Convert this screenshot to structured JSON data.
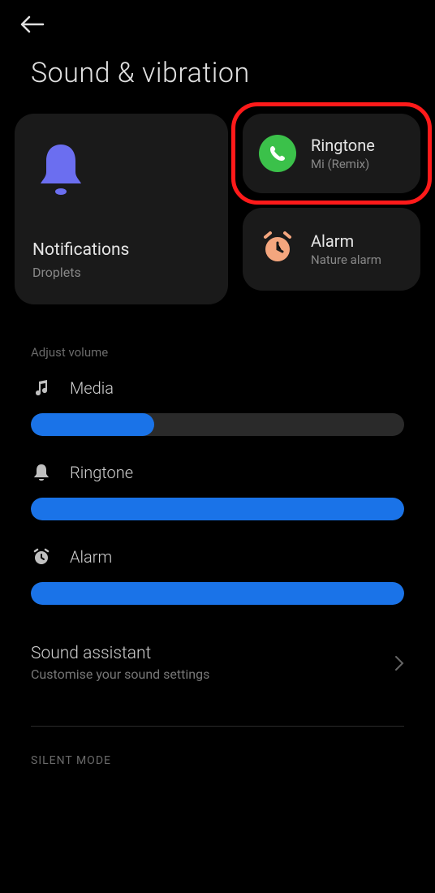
{
  "page": {
    "title": "Sound & vibration"
  },
  "cards": {
    "notifications": {
      "title": "Notifications",
      "sub": "Droplets"
    },
    "ringtone": {
      "title": "Ringtone",
      "sub": "Mi (Remix)"
    },
    "alarm": {
      "title": "Alarm",
      "sub": "Nature alarm"
    }
  },
  "volumes": {
    "section_label": "Adjust volume",
    "media": {
      "label": "Media",
      "percent": 33
    },
    "ringtone": {
      "label": "Ringtone",
      "percent": 100
    },
    "alarm": {
      "label": "Alarm",
      "percent": 100
    }
  },
  "assistant": {
    "title": "Sound assistant",
    "sub": "Customise your sound settings"
  },
  "silent_section": {
    "label": "SILENT MODE"
  }
}
